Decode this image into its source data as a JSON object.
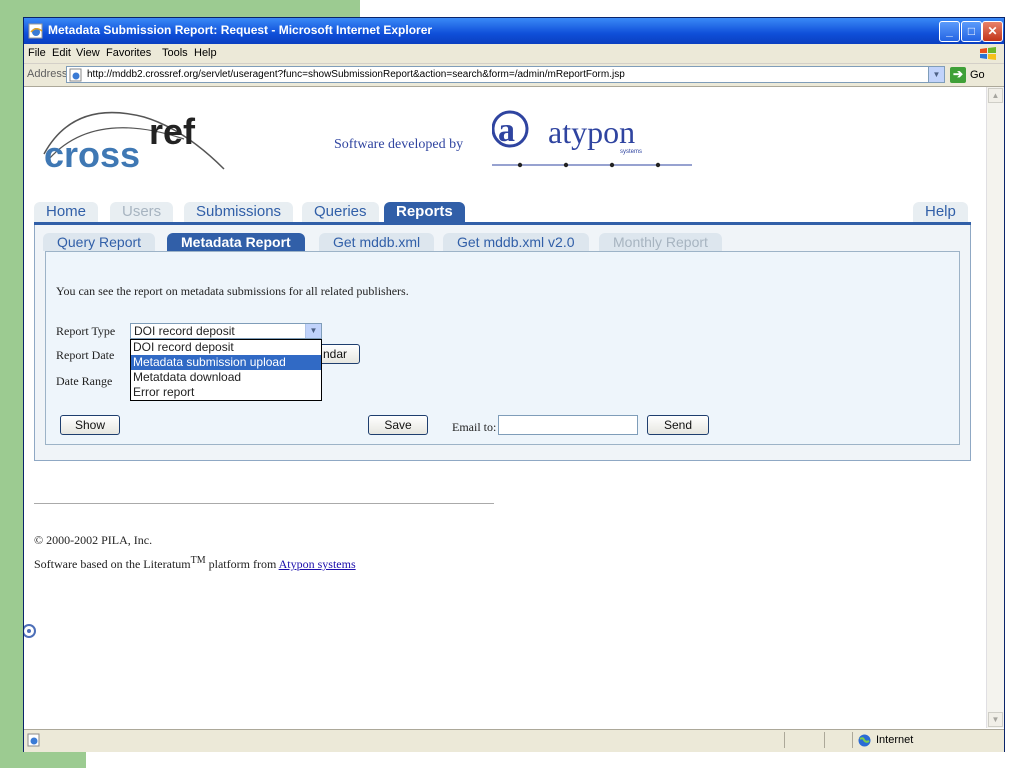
{
  "window": {
    "title": "Metadata Submission Report: Request - Microsoft Internet Explorer",
    "controls": {
      "minimize": "_",
      "maximize": "□",
      "close": "✕"
    }
  },
  "menu": {
    "items": [
      "File",
      "Edit",
      "View",
      "Favorites",
      "Tools",
      "Help"
    ]
  },
  "address": {
    "label": "Address",
    "url": "http://mddb2.crossref.org/servlet/useragent?func=showSubmissionReport&action=search&form=/admin/mReportForm.jsp",
    "go_label": "Go"
  },
  "header": {
    "logo_text_left": "cross",
    "logo_text_right": "ref",
    "software_developed_by": "Software developed by",
    "atypon_text": "atypon",
    "atypon_sub": "systems"
  },
  "nav": {
    "tabs": [
      {
        "label": "Home",
        "state": "normal"
      },
      {
        "label": "Users",
        "state": "disabled"
      },
      {
        "label": "Submissions",
        "state": "normal"
      },
      {
        "label": "Queries",
        "state": "normal"
      },
      {
        "label": "Reports",
        "state": "active"
      }
    ],
    "help_label": "Help"
  },
  "subnav": {
    "tabs": [
      {
        "label": "Query Report",
        "state": "normal"
      },
      {
        "label": "Metadata Report",
        "state": "active"
      },
      {
        "label": "Get mddb.xml",
        "state": "normal"
      },
      {
        "label": "Get mddb.xml v2.0",
        "state": "normal"
      },
      {
        "label": "Monthly Report",
        "state": "disabled"
      }
    ]
  },
  "form": {
    "intro": "You can see the report on metadata submissions for all related publishers.",
    "report_type_label": "Report Type",
    "report_type_value": "DOI record deposit",
    "report_type_options": [
      "DOI record deposit",
      "Metadata submission upload",
      "Metatdata download",
      "Error report"
    ],
    "report_type_highlighted_index": 1,
    "report_date_label": "Report Date",
    "calendar_button_visible": "ndar",
    "date_range_label": "Date Range",
    "show_button": "Show",
    "save_button": "Save",
    "email_label": "Email to:",
    "email_value": "",
    "send_button": "Send"
  },
  "footer": {
    "copyright": "© 2000-2002 PILA, Inc.",
    "software_based_prefix": "Software based on the Literatum",
    "trademark": "TM",
    "platform_from": " platform from ",
    "link_text": "Atypon systems"
  },
  "status": {
    "zone": "Internet"
  },
  "colors": {
    "title_bar": "#0f4fd9",
    "tab_active": "#315fa8",
    "panel_bg": "#eef5fb",
    "page_side": "#9ccb91"
  }
}
